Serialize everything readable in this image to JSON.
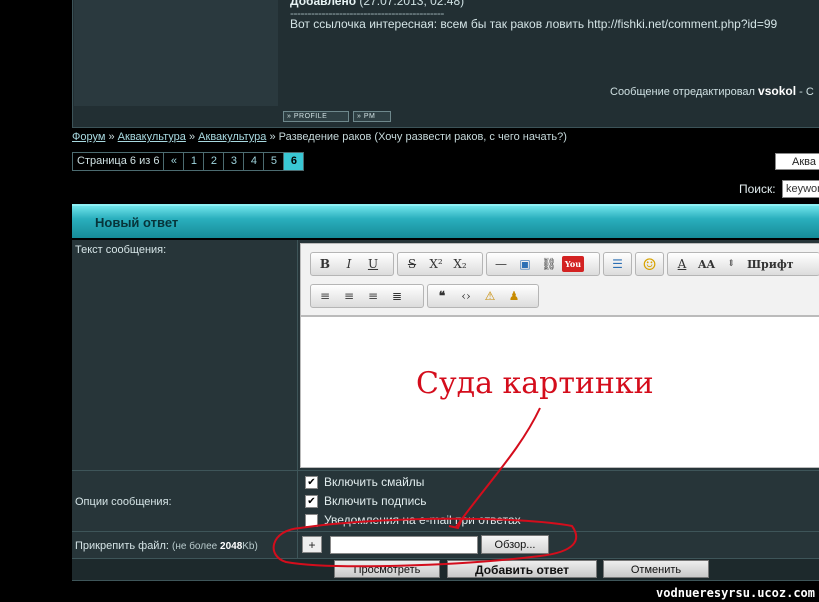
{
  "post": {
    "added_label": "Добавлено",
    "added_date": "(27.07.2013, 02:48)",
    "separator": "--------------------------------------------",
    "text": "Вот ссылочка интересная: всем бы так раков ловить http://fishki.net/comment.php?id=99",
    "edited_label": "Сообщение отредактировал",
    "edited_user": "vsokol",
    "edited_suffix": "- С",
    "profile_label": "PROFILE",
    "pm_label": "PM"
  },
  "breadcrumb": {
    "items": [
      "Форум",
      "Аквакультура",
      "Аквакультура"
    ],
    "sep": "»",
    "current": "Разведение раков",
    "description": "(Хочу развести раков, с чего начать?)"
  },
  "pagination": {
    "label": "Страница 6 из 6",
    "prev": "«",
    "pages": [
      "1",
      "2",
      "3",
      "4",
      "5",
      "6"
    ],
    "current": "6"
  },
  "right": {
    "select_value": "Аква",
    "search_label": "Поиск:",
    "search_value": "keywor"
  },
  "reply": {
    "title": "Новый ответ",
    "text_label": "Текст сообщения:",
    "options_label": "Опции сообщения:",
    "file_label": "Прикрепить файл:",
    "file_hint_prefix": "(не более",
    "file_hint_size": "2048",
    "file_hint_suffix": "Kb)"
  },
  "toolbar": {
    "row1": [
      "B",
      "I",
      "U",
      "S",
      "X²",
      "X₂",
      "—",
      "▣",
      "⛓",
      "You",
      "☰",
      "☺",
      "A",
      "AA",
      "Шрифт"
    ],
    "font_label": "Шрифт"
  },
  "options": [
    {
      "label": "Включить смайлы",
      "checked": true
    },
    {
      "label": "Включить подпись",
      "checked": true
    },
    {
      "label": "Уведомления на e-mail при ответах",
      "checked": false
    }
  ],
  "file": {
    "add": "+",
    "browse": "Обзор..."
  },
  "buttons": {
    "preview": "Просмотреть",
    "submit": "Добавить ответ",
    "cancel": "Отменить"
  },
  "annotation": {
    "text": "Суда  картинки",
    "color": "#d40d1c"
  },
  "watermark": "vodnueresyrsu.ucoz.com"
}
